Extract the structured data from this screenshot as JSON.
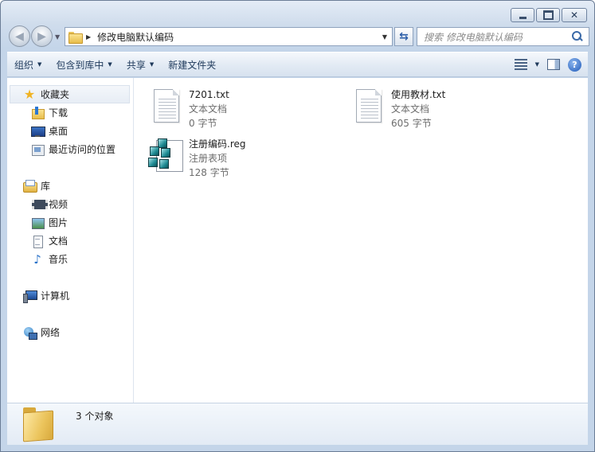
{
  "address": {
    "path": "修改电脑默认编码"
  },
  "search": {
    "placeholder": "搜索 修改电脑默认编码"
  },
  "toolbar": {
    "organize": "组织",
    "include_library": "包含到库中",
    "share": "共享",
    "new_folder": "新建文件夹"
  },
  "sidebar": {
    "favorites": {
      "label": "收藏夹",
      "items": [
        "下载",
        "桌面",
        "最近访问的位置"
      ]
    },
    "libraries": {
      "label": "库",
      "items": [
        "视频",
        "图片",
        "文档",
        "音乐"
      ]
    },
    "computer": {
      "label": "计算机"
    },
    "network": {
      "label": "网络"
    }
  },
  "files": [
    {
      "name": "7201.txt",
      "type": "文本文档",
      "size": "0 字节",
      "icon": "text-file-icon"
    },
    {
      "name": "使用教材.txt",
      "type": "文本文档",
      "size": "605 字节",
      "icon": "text-file-icon"
    },
    {
      "name": "注册编码.reg",
      "type": "注册表项",
      "size": "128 字节",
      "icon": "registry-file-icon"
    }
  ],
  "details": {
    "count_text": "3 个对象"
  },
  "colors": {
    "accent": "#1e395b",
    "selection_bg": "#e7edf5",
    "chrome": "#c4d5e9"
  }
}
